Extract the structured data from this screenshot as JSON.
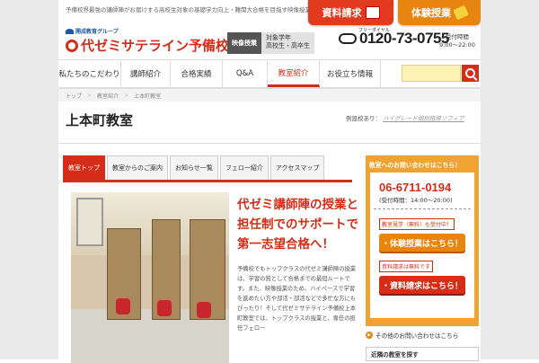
{
  "topline": {
    "tagline": "予備校界最強の講師陣がお届けする高校生対象の基礎学力向上・難関大合格を目指す映像授業"
  },
  "cta": {
    "request": "資料請求",
    "trial": "体験授業"
  },
  "header": {
    "group": "開成教育グループ",
    "brand": "代ゼミサテライン予備校",
    "badge_main": "映像授業",
    "badge_target": "対象学年",
    "badge_grade": "高校生・高卒生",
    "freedial": "フリーダイヤル",
    "phone": "0120-73-0755",
    "hours_label": "受付時間",
    "hours": "9:00～22:00"
  },
  "nav": {
    "items": [
      "私たちのこだわり",
      "講師紹介",
      "合格実績",
      "Q&A",
      "教室紹介",
      "お役立ち情報"
    ],
    "active_index": 4
  },
  "breadcrumb": [
    "トップ",
    "教室紹介",
    "上本町教室"
  ],
  "page": {
    "title": "上本町教室",
    "example_label": "例設校あり：",
    "example_link": "ハイグレード個別指導ソフィア"
  },
  "tabs": [
    "教室トップ",
    "教室からのご案内",
    "お知らせ一覧",
    "フェロー紹介",
    "アクセスマップ"
  ],
  "main": {
    "headline_1": "代ゼミ講師陣の授業と",
    "headline_2": "担任制でのサポートで",
    "headline_3": "第一志望合格へ！",
    "body": "予備校でもトップクラスの代ゼミ講師陣の授業は、学習の質として合格までの最短ルートです。また、映像授業のため、ハイペースで学習を進めたい方や部活・部活などで多忙な方にもぴったり！そして代ゼミサテライン予備校上本町教室では、トップクラスの授業と、専任の担任フェロー"
  },
  "sidebar": {
    "header": "教室へのお問い合わせはこちら！",
    "tel": "06-6711-0194",
    "reception": "(受付時間：14:00～20:00)",
    "trial_note": "教室見学（無料）も受付中！",
    "trial_btn": "・体験授業はこちら！",
    "doc_note": "資料請求は無料です",
    "doc_btn": "・資料請求はこちら！",
    "other": "その他のお問い合わせはこちら",
    "near": "近隣の教室を探す"
  },
  "colors": {
    "brand_red": "#d52d17",
    "accent_orange": "#e8850f",
    "sidebar_orange": "#f0a330"
  }
}
